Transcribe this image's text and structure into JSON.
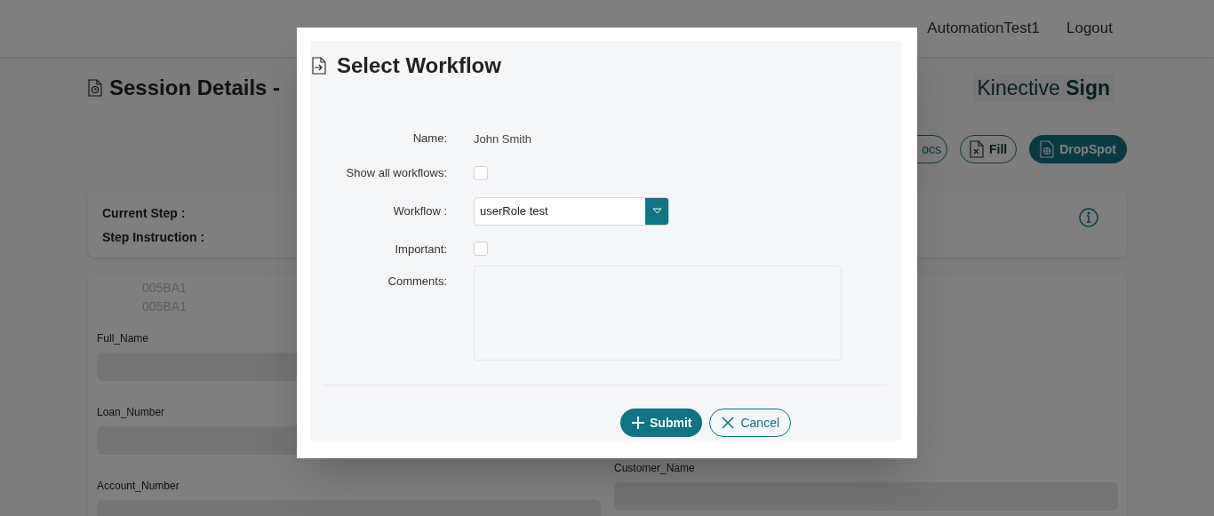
{
  "header": {
    "nav_items": [
      "AutomationTest1",
      "Logout"
    ]
  },
  "page": {
    "title": "Session Details -",
    "brand": {
      "light": "Kinective",
      "bold": "Sign"
    }
  },
  "toolbar": [
    {
      "kind": "outline",
      "label": "ocs"
    },
    {
      "kind": "outline-icon",
      "label": "Fill"
    },
    {
      "kind": "filled-icon",
      "label": "DropSpot"
    }
  ],
  "step_card": {
    "labels": [
      "Current Step :",
      "Step Instruction :"
    ]
  },
  "record_card": {
    "ids": [
      "005BA1",
      "005BA1"
    ],
    "left_fields": [
      "Full_Name",
      "Loan_Number",
      "Account_Number"
    ],
    "right_fields": [
      "Customer_Name"
    ]
  },
  "modal": {
    "title": "Select Workflow",
    "name_label": "Name:",
    "name_value": "John Smith",
    "show_all_label": "Show all workflows:",
    "show_all_checked": false,
    "workflow_label": "Workflow :",
    "workflow_value": "userRole test",
    "important_label": "Important:",
    "important_checked": false,
    "comments_label": "Comments:",
    "buttons": [
      {
        "kind": "primary",
        "label": "Submit"
      },
      {
        "kind": "secondary",
        "label": "Cancel"
      }
    ]
  }
}
